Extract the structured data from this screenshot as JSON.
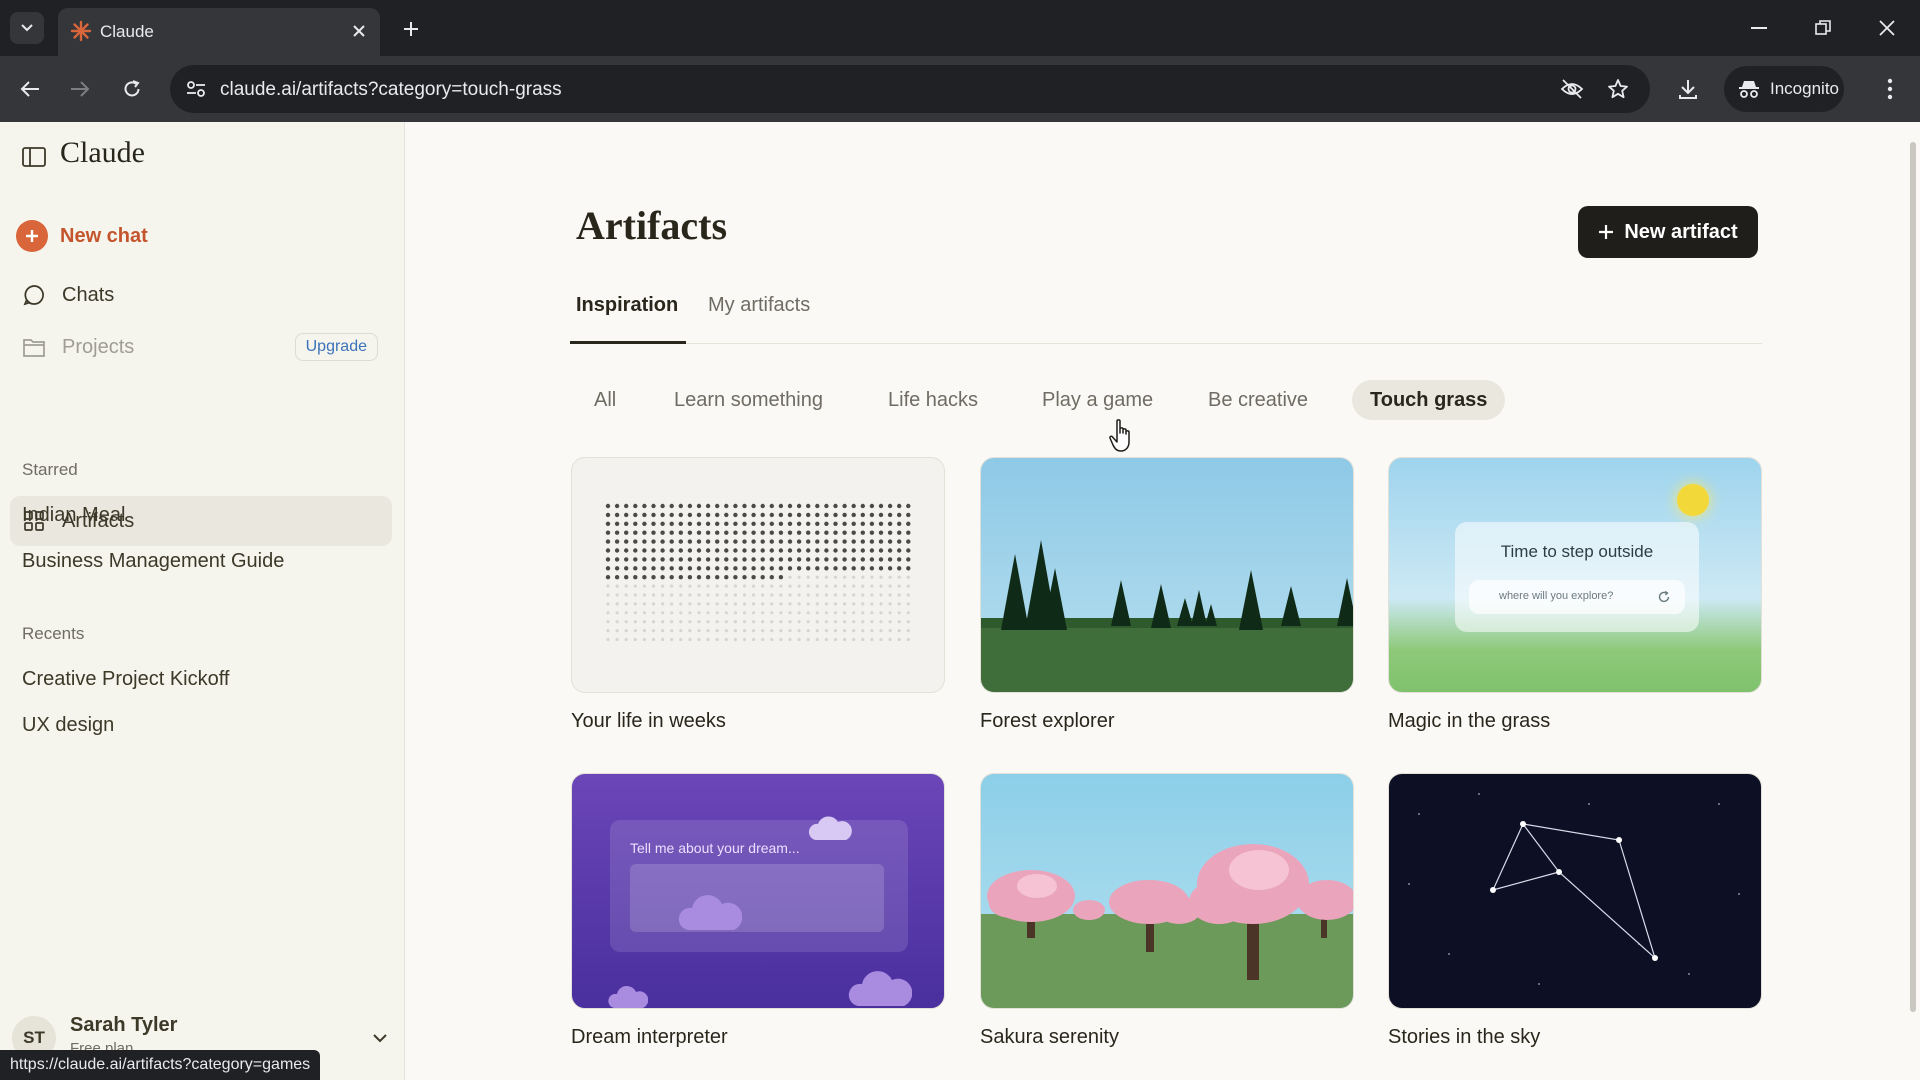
{
  "browser": {
    "tab_title": "Claude",
    "url": "claude.ai/artifacts?category=touch-grass",
    "incognito_label": "Incognito",
    "status_url": "https://claude.ai/artifacts?category=games"
  },
  "sidebar": {
    "brand": "Claude",
    "new_chat": "New chat",
    "nav": {
      "chats": "Chats",
      "projects": "Projects",
      "upgrade": "Upgrade",
      "artifacts": "Artifacts"
    },
    "starred_heading": "Starred",
    "starred": [
      "Indian Meal",
      "Business Management Guide"
    ],
    "recents_heading": "Recents",
    "recents": [
      "Creative Project Kickoff",
      "UX design"
    ],
    "user": {
      "initials": "ST",
      "name": "Sarah Tyler",
      "plan": "Free plan"
    }
  },
  "main": {
    "title": "Artifacts",
    "new_artifact": "New artifact",
    "tabs": [
      "Inspiration",
      "My artifacts"
    ],
    "active_tab": "Inspiration",
    "categories": [
      "All",
      "Learn something",
      "Life hacks",
      "Play a game",
      "Be creative",
      "Touch grass"
    ],
    "active_category": "Touch grass",
    "cards": [
      {
        "title": "Your life in weeks"
      },
      {
        "title": "Forest explorer"
      },
      {
        "title": "Magic in the grass",
        "preview_heading": "Time to step outside",
        "preview_input": "where will you explore?"
      },
      {
        "title": "Dream interpreter",
        "preview_heading": "Tell me about your dream..."
      },
      {
        "title": "Sakura serenity"
      },
      {
        "title": "Stories in the sky"
      }
    ]
  },
  "colors": {
    "accent": "#d9653b",
    "background": "#faf9f5",
    "sidebar": "#f5f4ed",
    "primary_button": "#1f1e1b"
  }
}
